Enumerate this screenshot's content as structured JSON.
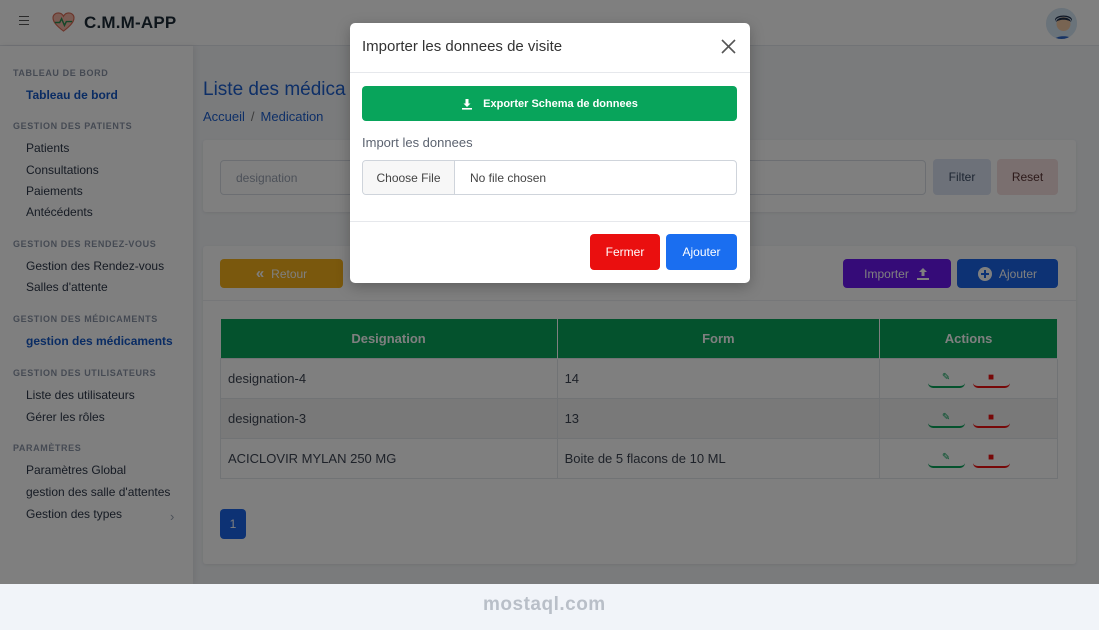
{
  "app": {
    "title": "C.M.M-APP"
  },
  "sidebar": {
    "sections": [
      {
        "heading": "TABLEAU DE BORD",
        "items": [
          {
            "label": "Tableau de bord"
          }
        ]
      },
      {
        "heading": "GESTION DES PATIENTS",
        "items": [
          {
            "label": "Patients"
          },
          {
            "label": "Consultations"
          },
          {
            "label": "Paiements"
          },
          {
            "label": "Antécédents"
          }
        ]
      },
      {
        "heading": "GESTION DES RENDEZ-VOUS",
        "items": [
          {
            "label": "Gestion des Rendez-vous"
          },
          {
            "label": "Salles d'attente"
          }
        ]
      },
      {
        "heading": "GESTION DES MÉDICAMENTS",
        "items": [
          {
            "label": "gestion des médicaments"
          }
        ]
      },
      {
        "heading": "GESTION DES UTILISATEURS",
        "items": [
          {
            "label": "Liste des utilisateurs"
          },
          {
            "label": "Gérer les rôles"
          }
        ]
      },
      {
        "heading": "PARAMÈTRES",
        "items": [
          {
            "label": "Paramètres Global"
          },
          {
            "label": "gestion des salle d'attentes"
          },
          {
            "label": "Gestion des types"
          }
        ]
      }
    ]
  },
  "page": {
    "title": "Liste des médica",
    "breadcrumb": {
      "home": "Accueil",
      "sep": "/",
      "current": "Medication"
    }
  },
  "filter": {
    "placeholder": "designation",
    "filter_label": "Filter",
    "reset_label": "Reset"
  },
  "toolbar": {
    "retour_label": "Retour",
    "importer_label": "Importer",
    "ajouter_label": "Ajouter"
  },
  "table": {
    "headers": [
      "Designation",
      "Form",
      "Actions"
    ],
    "rows": [
      {
        "designation": "designation-4",
        "form": "14"
      },
      {
        "designation": "designation-3",
        "form": "13"
      },
      {
        "designation": "ACICLOVIR MYLAN 250 MG",
        "form": "Boite de 5 flacons de 10 ML"
      }
    ]
  },
  "pagination": {
    "current": "1"
  },
  "modal": {
    "title": "Importer les donnees de visite",
    "export_label": "Exporter Schema de donnees",
    "import_label": "Import les donnees",
    "choose_file_label": "Choose File",
    "no_file_label": "No file chosen",
    "close_label": "Fermer",
    "add_label": "Ajouter"
  },
  "watermark": {
    "name": "mostaql.com"
  },
  "colors": {
    "primary": "#1a65e8",
    "success": "#08a45b",
    "danger": "#ea0f0f",
    "warning": "#f5b01a",
    "purple": "#6a16f0"
  }
}
